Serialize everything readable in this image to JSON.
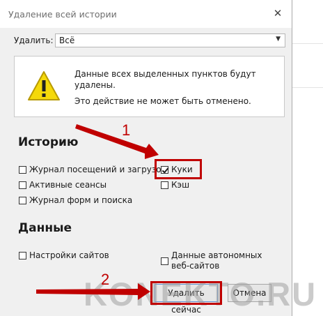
{
  "dialog": {
    "title": "Удаление всей истории",
    "delete_label": "Удалить:",
    "delete_range": "Всё",
    "warning_line1": "Данные всех выделенных пунктов будут удалены.",
    "warning_line2": "Это действие не может быть отменено."
  },
  "history": {
    "heading": "Историю",
    "items": [
      {
        "label": "Журнал посещений и загрузок",
        "checked": false
      },
      {
        "label": "Куки",
        "checked": true
      },
      {
        "label": "Активные сеансы",
        "checked": false
      },
      {
        "label": "Кэш",
        "checked": false
      },
      {
        "label": "Журнал форм и поиска",
        "checked": false
      }
    ]
  },
  "data": {
    "heading": "Данные",
    "items": [
      {
        "label": "Настройки сайтов",
        "checked": false
      },
      {
        "label": "Данные автономных веб-сайтов",
        "checked": false
      }
    ]
  },
  "buttons": {
    "clear_now": "Удалить сейчас",
    "cancel": "Отмена"
  },
  "annotations": {
    "step1": "1",
    "step2": "2",
    "watermark": "KONEKTO.RU"
  },
  "colors": {
    "annotation_red": "#c00000",
    "dialog_bg": "#f0f0f0"
  },
  "icons": {
    "warning": "warning-triangle-icon",
    "close": "close-icon",
    "dropdown": "chevron-down-icon"
  }
}
